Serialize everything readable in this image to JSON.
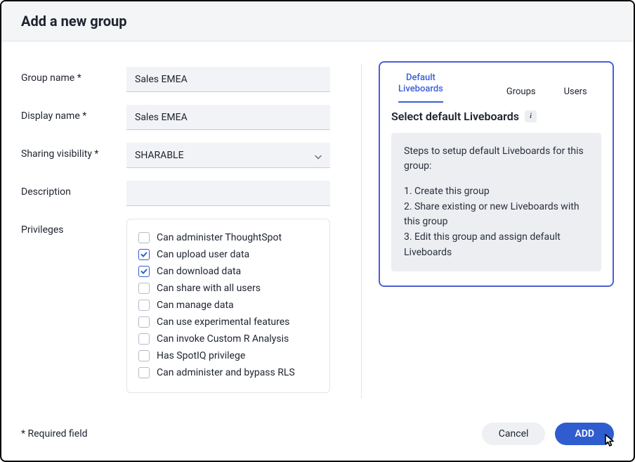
{
  "title": "Add a new group",
  "labels": {
    "group_name": "Group name *",
    "display_name": "Display name *",
    "sharing_visibility": "Sharing visibility *",
    "description": "Description",
    "privileges": "Privileges"
  },
  "fields": {
    "group_name": "Sales EMEA",
    "display_name": "Sales EMEA",
    "sharing_visibility": "SHARABLE",
    "description": ""
  },
  "privileges": [
    {
      "label": "Can administer ThoughtSpot",
      "checked": false
    },
    {
      "label": "Can upload user data",
      "checked": true
    },
    {
      "label": "Can download data",
      "checked": true
    },
    {
      "label": "Can share with all users",
      "checked": false
    },
    {
      "label": "Can manage data",
      "checked": false
    },
    {
      "label": "Can use experimental features",
      "checked": false
    },
    {
      "label": "Can invoke Custom R Analysis",
      "checked": false
    },
    {
      "label": "Has SpotIQ privilege",
      "checked": false
    },
    {
      "label": "Can administer and bypass RLS",
      "checked": false
    }
  ],
  "panel": {
    "tabs": [
      {
        "label": "Default\nLiveboards",
        "active": true
      },
      {
        "label": "Groups",
        "active": false
      },
      {
        "label": "Users",
        "active": false
      }
    ],
    "section_title": "Select default Liveboards",
    "steps_intro": "Steps to setup default Liveboards for this group:",
    "steps": [
      "1. Create this group",
      "2. Share existing or new Liveboards with this group",
      "3. Edit this group and assign default Liveboards"
    ]
  },
  "footer": {
    "required_note": "* Required field",
    "cancel": "Cancel",
    "add": "ADD"
  }
}
